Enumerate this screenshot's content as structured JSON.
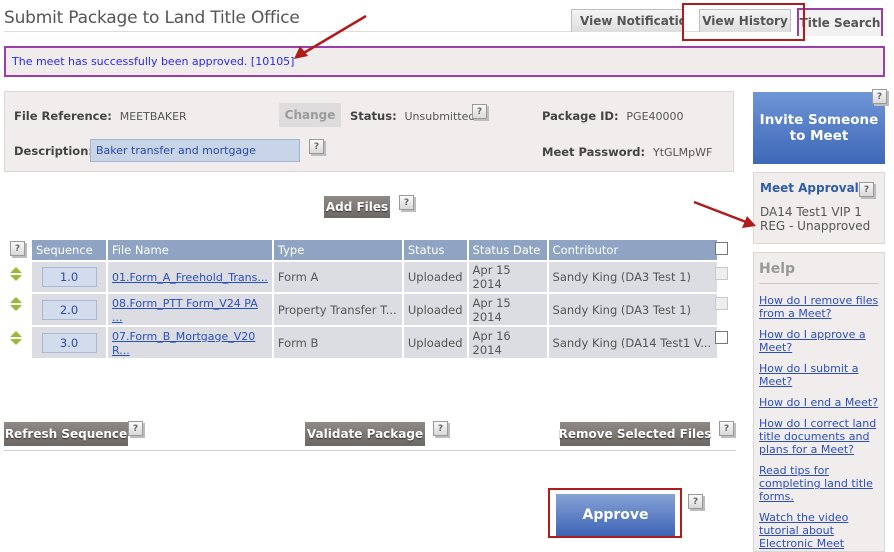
{
  "page": {
    "title": "Submit Package to Land Title Office"
  },
  "tabs": [
    {
      "label": "View Notifications"
    },
    {
      "label": "View History"
    },
    {
      "label": "Title Search"
    }
  ],
  "message": "The meet has successfully been approved. [10105]",
  "info": {
    "file_reference_label": "File Reference:",
    "file_reference_value": "MEETBAKER",
    "change_label": "Change",
    "status_label": "Status:",
    "status_value": "Unsubmitted",
    "package_id_label": "Package ID:",
    "package_id_value": "PGE40000",
    "description_label": "Description:",
    "description_value": "Baker transfer and mortgage",
    "meet_password_label": "Meet Password:",
    "meet_password_value": "YtGLMpWF"
  },
  "help_glyph": "?",
  "add_files_label": "Add Files",
  "table": {
    "columns": [
      "Sequence",
      "File Name",
      "Type",
      "Status",
      "Status Date",
      "Contributor"
    ],
    "rows": [
      {
        "sequence": "1.0",
        "file_name": "01.Form_A_Freehold_Trans...",
        "type": "Form A",
        "status": "Uploaded",
        "status_date": "Apr 15 2014",
        "contributor": "Sandy King (DA3 Test 1)"
      },
      {
        "sequence": "2.0",
        "file_name": "08.Form_PTT Form_V24 PA ...",
        "type": "Property Transfer T...",
        "status": "Uploaded",
        "status_date": "Apr 15 2014",
        "contributor": "Sandy King (DA3 Test 1)"
      },
      {
        "sequence": "3.0",
        "file_name": "07.Form_B_Mortgage_V20 R...",
        "type": "Form B",
        "status": "Uploaded",
        "status_date": "Apr 16 2014",
        "contributor": "Sandy King (DA14 Test1 V..."
      }
    ]
  },
  "buttons": {
    "refresh": "Refresh Sequence",
    "validate": "Validate Package",
    "remove": "Remove Selected Files",
    "approve": "Approve"
  },
  "sidebar": {
    "invite_label": "Invite Someone to Meet",
    "approvals_title": "Meet Approvals",
    "approvals_text": "DA14 Test1 VIP 1 REG - Unapproved",
    "help_title": "Help",
    "help_links": [
      "How do I remove files from a Meet?",
      "How do I approve a Meet?",
      "How do I submit a Meet?",
      "How do I end a Meet?",
      "How do I correct land title documents and plans for a Meet?",
      "Read tips for completing land title forms.",
      "Watch the video tutorial about Electronic Meet"
    ]
  },
  "colors": {
    "accent_blue": "#3e68b8",
    "highlight_red": "#b01c1c",
    "message_border": "#9b3fa8",
    "message_text": "#2a2ae8"
  }
}
